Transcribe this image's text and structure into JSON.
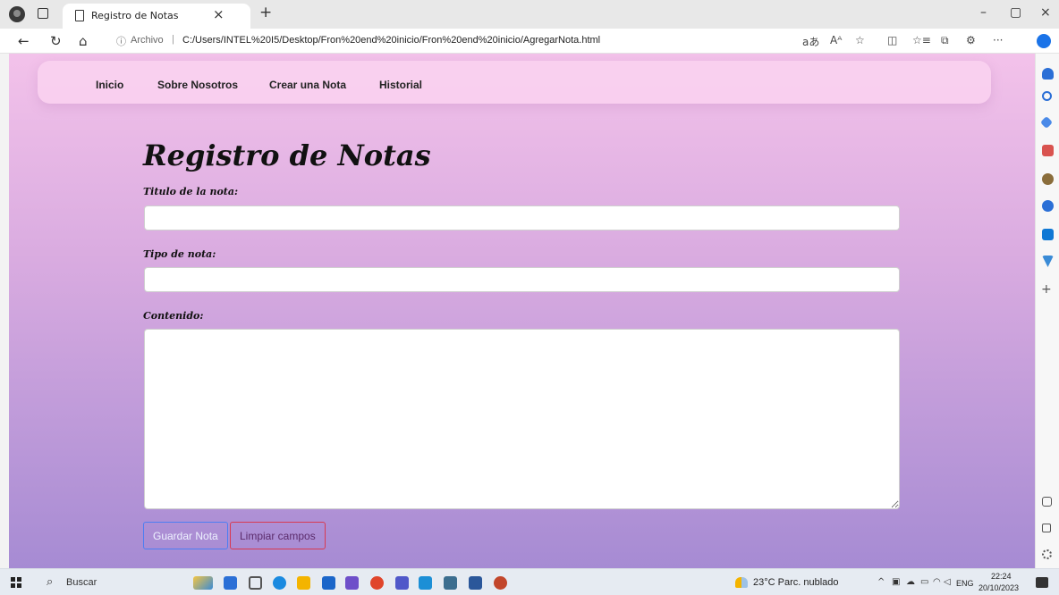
{
  "browser": {
    "tab_title": "Registro de Notas",
    "tab_close": "×",
    "new_tab": "+",
    "address": {
      "info_icon": "ⓘ",
      "scheme_label": "Archivo",
      "separator": "|",
      "url": "C:/Users/INTEL%20I5/Desktop/Fron%20end%20inicio/Fron%20end%20inicio/AgregarNota.html"
    },
    "window_controls": {
      "minimize": "–",
      "restore": "▢",
      "close": "×"
    },
    "toolbar_glyphs": {
      "back": "←",
      "refresh": "↻",
      "home": "⌂",
      "read_aloud": "aあ",
      "text_size": "Aᴬ",
      "favorite": "☆",
      "split": "◫",
      "favorites_bar": "☆≡",
      "collections": "⧉",
      "extensions": "⚙",
      "more": "···"
    },
    "sidebar_plus": "+"
  },
  "nav": {
    "items": [
      {
        "label": "Inicio"
      },
      {
        "label": "Sobre Nosotros"
      },
      {
        "label": "Crear una Nota"
      },
      {
        "label": "Historial"
      }
    ]
  },
  "form": {
    "title": "Registro de Notas",
    "title_label": "Titulo de la nota:",
    "title_value": "",
    "type_label": "Tipo de nota:",
    "type_value": "",
    "content_label": "Contenido:",
    "content_value": "",
    "save_button": "Guardar Nota",
    "clear_button": "Limpiar campos"
  },
  "taskbar": {
    "search_placeholder": "Buscar",
    "weather": "23°C  Parc. nublado",
    "language": "ENG",
    "time": "22:24",
    "date": "20/10/2023"
  },
  "colors": {
    "gradient_top": "#f3c2ea",
    "gradient_bottom": "#a68bd3",
    "save_border": "#4d7ef2",
    "clear_border": "#d83a52"
  }
}
